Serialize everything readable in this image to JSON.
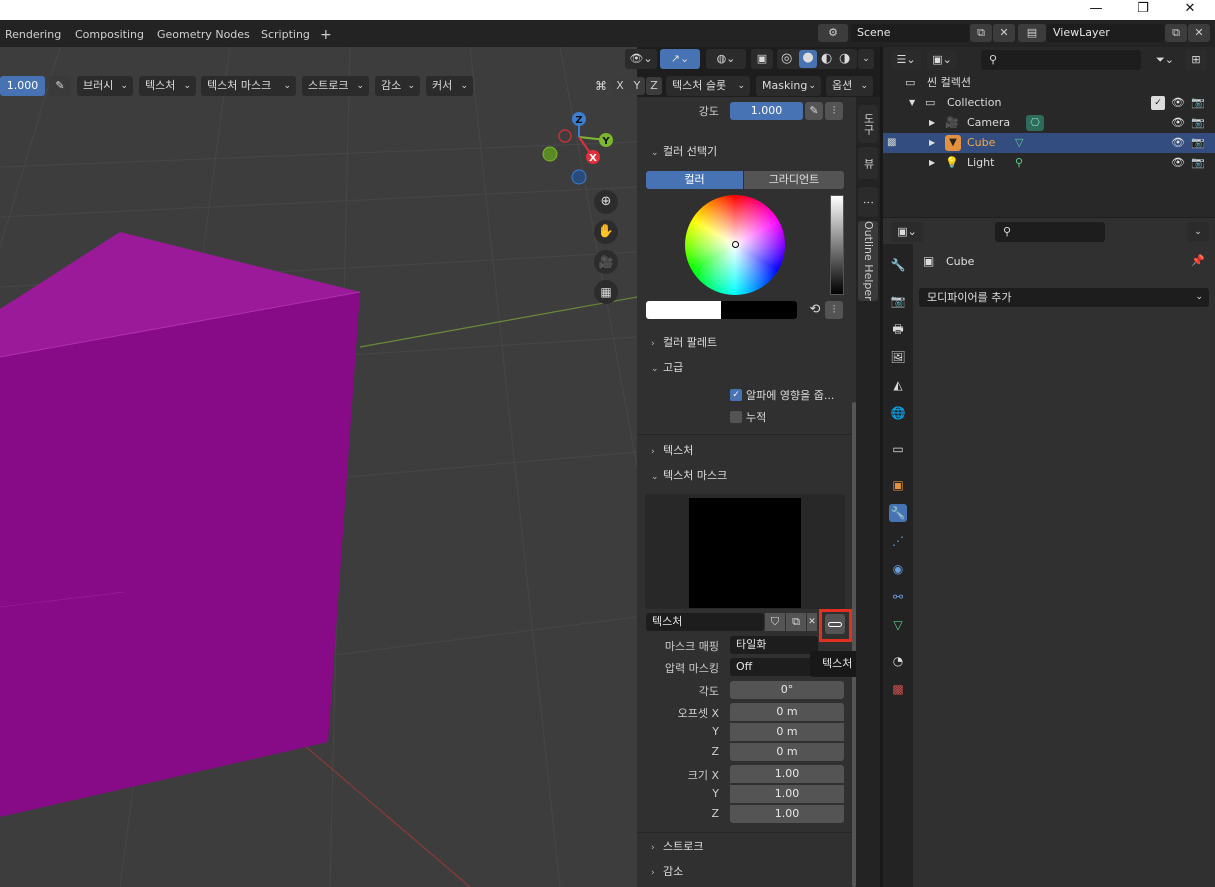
{
  "window": {
    "minimize": "—",
    "maximize": "❐",
    "close": "✕"
  },
  "workspace_tabs": [
    "Rendering",
    "Compositing",
    "Geometry Nodes",
    "Scripting"
  ],
  "workspace_add": "+",
  "scene": {
    "name": "Scene",
    "view_layer": "ViewLayer"
  },
  "tool_header": {
    "strength_value": "1.000",
    "menus": [
      "브러시",
      "텍스처",
      "텍스처 마스크",
      "스트로크",
      "감소",
      "커서"
    ],
    "axes": [
      "X",
      "Y",
      "Z"
    ],
    "slot_menu": "텍스처 슬롯",
    "masking_menu": "Masking",
    "options_menu": "옵션"
  },
  "gizmo": {
    "z": "Z",
    "y": "Y",
    "x": "X"
  },
  "npanel": {
    "strength_label": "강도",
    "strength_value": "1.000",
    "color_picker_title": "컬러 선택기",
    "color_tab": "컬러",
    "gradient_tab": "그라디언트",
    "color_palette": "컬러 팔레트",
    "advanced": "고급",
    "affect_alpha": "알파에 영향을 줍...",
    "accumulate": "누적",
    "texture": "텍스처",
    "texture_mask": "텍스처 마스크",
    "texture_name": "텍스처",
    "mask_mapping_label": "마스크 매핑",
    "mask_mapping_value": "타일화",
    "pressure_masking_label": "압력 마스킹",
    "pressure_masking_value": "Off",
    "angle_label": "각도",
    "angle_value": "0°",
    "offset_x_label": "오프셋 X",
    "offset_y_label": "Y",
    "offset_z_label": "Z",
    "offset_x": "0 m",
    "offset_y": "0 m",
    "offset_z": "0 m",
    "size_x_label": "크기 X",
    "size_y_label": "Y",
    "size_z_label": "Z",
    "size_x": "1.00",
    "size_y": "1.00",
    "size_z": "1.00",
    "stroke": "스트로크",
    "falloff": "감소",
    "tooltip": "텍스처 탭의 텍스처를 보기."
  },
  "sidebar_tabs": [
    "도구",
    "뷰",
    "Outline Helper"
  ],
  "outliner": {
    "scene_collection": "씬 컬렉션",
    "collection": "Collection",
    "items": [
      "Camera",
      "Cube",
      "Light"
    ]
  },
  "properties": {
    "object_name": "Cube",
    "add_modifier": "모디파이어를 추가"
  },
  "colors": {
    "accent": "#4772b3",
    "highlight": "#e1301f",
    "cube": "#8c0a8c"
  }
}
